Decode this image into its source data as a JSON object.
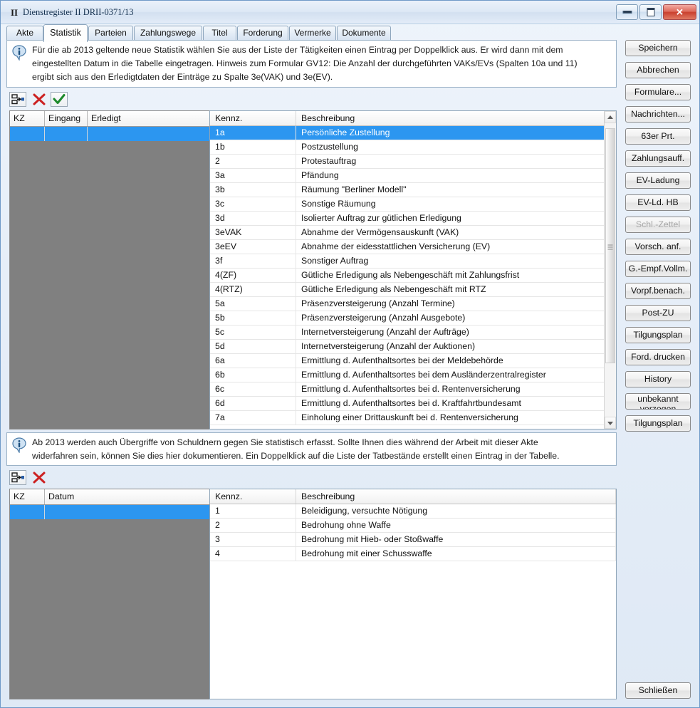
{
  "window": {
    "title": "Dienstregister II DRII-0371/13",
    "app_icon": "II",
    "controls": {
      "minimize": "minimize-icon",
      "maximize": "maximize-icon",
      "close": "close-icon"
    }
  },
  "tabs": [
    {
      "label": "Akte",
      "active": false
    },
    {
      "label": "Statistik",
      "active": true
    },
    {
      "label": "Parteien",
      "active": false
    },
    {
      "label": "Zahlungswege",
      "active": false
    },
    {
      "label": "Titel",
      "active": false
    },
    {
      "label": "Forderung",
      "active": false
    },
    {
      "label": "Vermerke",
      "active": false
    },
    {
      "label": "Dokumente",
      "active": false
    }
  ],
  "top_info": {
    "icon": "info-icon",
    "line1": "Für die ab 2013 geltende neue Statistik wählen Sie aus der Liste der Tätigkeiten einen Eintrag per Doppelklick aus. Er wird dann mit dem",
    "line2": "eingestellten Datum in die Tabelle eingetragen. Hinweis zum Formular GV12: Die Anzahl der durchgeführten VAKs/EVs (Spalten 10a und 11)",
    "line3": "ergibt sich aus den Erledigtdaten der Einträge zu Spalte 3e(VAK) und 3e(EV)."
  },
  "top_toolbar": [
    {
      "name": "insert-row-icon",
      "title": "Eintrag einfügen"
    },
    {
      "name": "delete-row-icon",
      "title": "Eintrag löschen"
    },
    {
      "name": "confirm-check-icon",
      "title": "Übernehmen"
    }
  ],
  "top_table": {
    "columns": [
      "KZ",
      "Eingang",
      "Erledigt"
    ],
    "rows": [
      {
        "kz": "",
        "eingang": "",
        "erledigt": "",
        "selected": true
      }
    ]
  },
  "top_list": {
    "columns": [
      "Kennz.",
      "Beschreibung"
    ],
    "rows": [
      {
        "kennz": "1a",
        "beschreibung": "Persönliche Zustellung",
        "selected": true
      },
      {
        "kennz": "1b",
        "beschreibung": "Postzustellung",
        "selected": false
      },
      {
        "kennz": "2",
        "beschreibung": "Protestauftrag",
        "selected": false
      },
      {
        "kennz": "3a",
        "beschreibung": "Pfändung",
        "selected": false
      },
      {
        "kennz": "3b",
        "beschreibung": "Räumung \"Berliner Modell\"",
        "selected": false
      },
      {
        "kennz": "3c",
        "beschreibung": "Sonstige Räumung",
        "selected": false
      },
      {
        "kennz": "3d",
        "beschreibung": "Isolierter Auftrag zur gütlichen Erledigung",
        "selected": false
      },
      {
        "kennz": "3eVAK",
        "beschreibung": "Abnahme der Vermögensauskunft (VAK)",
        "selected": false
      },
      {
        "kennz": "3eEV",
        "beschreibung": "Abnahme der eidesstattlichen Versicherung (EV)",
        "selected": false
      },
      {
        "kennz": "3f",
        "beschreibung": "Sonstiger Auftrag",
        "selected": false
      },
      {
        "kennz": "4(ZF)",
        "beschreibung": "Gütliche Erledigung als Nebengeschäft mit Zahlungsfrist",
        "selected": false
      },
      {
        "kennz": "4(RTZ)",
        "beschreibung": "Gütliche Erledigung als Nebengeschäft mit RTZ",
        "selected": false
      },
      {
        "kennz": "5a",
        "beschreibung": "Präsenzversteigerung (Anzahl Termine)",
        "selected": false
      },
      {
        "kennz": "5b",
        "beschreibung": "Präsenzversteigerung (Anzahl Ausgebote)",
        "selected": false
      },
      {
        "kennz": "5c",
        "beschreibung": "Internetversteigerung (Anzahl der Aufträge)",
        "selected": false
      },
      {
        "kennz": "5d",
        "beschreibung": "Internetversteigerung (Anzahl der Auktionen)",
        "selected": false
      },
      {
        "kennz": "6a",
        "beschreibung": "Ermittlung d. Aufenthaltsortes bei der Meldebehörde",
        "selected": false
      },
      {
        "kennz": "6b",
        "beschreibung": "Ermittlung d. Aufenthaltsortes bei dem Ausländerzentralregister",
        "selected": false
      },
      {
        "kennz": "6c",
        "beschreibung": "Ermittlung d. Aufenthaltsortes bei d. Rentenversicherung",
        "selected": false
      },
      {
        "kennz": "6d",
        "beschreibung": "Ermittlung d. Aufenthaltsortes bei d. Kraftfahrtbundesamt",
        "selected": false
      },
      {
        "kennz": "7a",
        "beschreibung": "Einholung einer Drittauskunft bei d. Rentenversicherung",
        "selected": false
      }
    ]
  },
  "bottom_info": {
    "icon": "info-icon",
    "line1": "Ab 2013 werden auch Übergriffe von Schuldnern gegen Sie statistisch erfasst. Sollte Ihnen dies während der Arbeit mit dieser Akte",
    "line2": "widerfahren sein, können Sie dies hier dokumentieren. Ein Doppelklick auf die Liste der Tatbestände erstellt einen Eintrag in der Tabelle."
  },
  "bottom_toolbar": [
    {
      "name": "insert-row-icon",
      "title": "Eintrag einfügen"
    },
    {
      "name": "delete-row-icon",
      "title": "Eintrag löschen"
    }
  ],
  "bottom_table": {
    "columns": [
      "KZ",
      "Datum"
    ],
    "rows": [
      {
        "kz": "",
        "datum": "",
        "selected": true
      }
    ]
  },
  "bottom_list": {
    "columns": [
      "Kennz.",
      "Beschreibung"
    ],
    "rows": [
      {
        "kennz": "1",
        "beschreibung": "Beleidigung, versuchte Nötigung"
      },
      {
        "kennz": "2",
        "beschreibung": "Bedrohung ohne Waffe"
      },
      {
        "kennz": "3",
        "beschreibung": "Bedrohung mit Hieb- oder Stoßwaffe"
      },
      {
        "kennz": "4",
        "beschreibung": "Bedrohung mit einer Schusswaffe"
      }
    ]
  },
  "side_buttons": [
    {
      "label": "Speichern",
      "disabled": false
    },
    {
      "label": "Abbrechen",
      "disabled": false
    },
    {
      "label": "Formulare...",
      "disabled": false
    },
    {
      "label": "Nachrichten...",
      "disabled": false
    },
    {
      "label": "63er Prt.",
      "disabled": false
    },
    {
      "label": "Zahlungsauff.",
      "disabled": false
    },
    {
      "label": "EV-Ladung",
      "disabled": false
    },
    {
      "label": "EV-Ld. HB",
      "disabled": false
    },
    {
      "label": "Schl.-Zettel",
      "disabled": true
    },
    {
      "label": "Vorsch. anf.",
      "disabled": false
    },
    {
      "label": "G.-Empf.Vollm.",
      "disabled": false
    },
    {
      "label": "Vorpf.benach.",
      "disabled": false
    },
    {
      "label": "Post-ZU",
      "disabled": false
    },
    {
      "label": "Tilgungsplan",
      "disabled": false
    },
    {
      "label": "Ford. drucken",
      "disabled": false
    },
    {
      "label": "History",
      "disabled": false
    },
    {
      "label": "unbekannt verzogen",
      "disabled": false
    },
    {
      "label": "Tilgungsplan",
      "disabled": false
    }
  ],
  "close_button": {
    "label": "Schließen"
  },
  "colors": {
    "selection": "#2c96f0",
    "window_frame": "#6f9ac8",
    "table_fill": "#808080",
    "close_button": "#c9402f"
  }
}
